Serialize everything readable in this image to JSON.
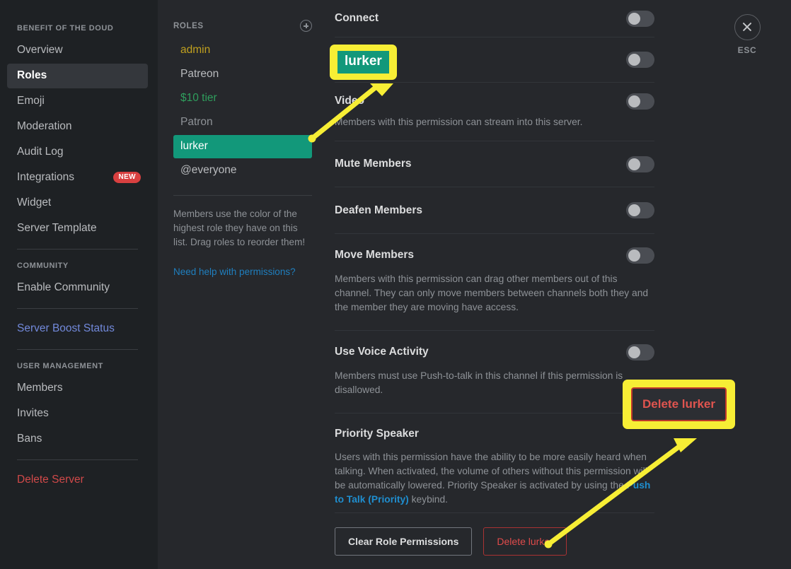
{
  "sidebar": {
    "server_header": "BENEFIT OF THE DOUD",
    "items": [
      {
        "label": "Overview"
      },
      {
        "label": "Roles"
      },
      {
        "label": "Emoji"
      },
      {
        "label": "Moderation"
      },
      {
        "label": "Audit Log"
      },
      {
        "label": "Integrations",
        "badge": "NEW"
      },
      {
        "label": "Widget"
      },
      {
        "label": "Server Template"
      }
    ],
    "community_header": "COMMUNITY",
    "community_items": [
      {
        "label": "Enable Community"
      }
    ],
    "boost_label": "Server Boost Status",
    "user_management_header": "USER MANAGEMENT",
    "user_items": [
      {
        "label": "Members"
      },
      {
        "label": "Invites"
      },
      {
        "label": "Bans"
      }
    ],
    "delete_server_label": "Delete Server"
  },
  "roles_panel": {
    "title": "ROLES",
    "add_icon": "plus-circle-icon",
    "roles": [
      {
        "label": "admin",
        "color": "#c0a01f"
      },
      {
        "label": "Patreon",
        "color": "#b9bbbe"
      },
      {
        "label": "$10 tier",
        "color": "#2f9e5d"
      },
      {
        "label": "Patron",
        "color": "#8e9297"
      },
      {
        "label": "lurker",
        "color": "#ffffff",
        "selected": true
      },
      {
        "label": "@everyone",
        "color": "#b9bbbe"
      }
    ],
    "help_text": "Members use the color of the highest role they have on this list. Drag roles to reorder them!",
    "help_link": "Need help with permissions?"
  },
  "permissions": [
    {
      "name": "Connect",
      "description": "",
      "enabled": false,
      "hidden_label": false
    },
    {
      "name": "",
      "description": "",
      "enabled": false,
      "hidden_label": true
    },
    {
      "name": "Video",
      "description": "Members with this permission can stream into this server.",
      "enabled": false,
      "hidden_label": false
    },
    {
      "name": "Mute Members",
      "description": "",
      "enabled": false,
      "hidden_label": false
    },
    {
      "name": "Deafen Members",
      "description": "",
      "enabled": false,
      "hidden_label": false
    },
    {
      "name": "Move Members",
      "description": "Members with this permission can drag other members out of this channel. They can only move members between channels both they and the member they are moving have access.",
      "enabled": false,
      "hidden_label": false
    },
    {
      "name": "Use Voice Activity",
      "description": "Members must use Push-to-talk in this channel if this permission is disallowed.",
      "enabled": false,
      "hidden_label": false
    }
  ],
  "priority_speaker": {
    "name": "Priority Speaker",
    "desc_part1": "Users with this permission have the ability to be more easily heard when talking. When activated, the volume of others without this permission will be automatically lowered. Priority Speaker is activated by using the ",
    "link_text": "Push to Talk (Priority)",
    "desc_part2": " keybind."
  },
  "footer_buttons": {
    "clear_label": "Clear Role Permissions",
    "delete_label": "Delete lurker"
  },
  "close": {
    "icon": "close-x-icon",
    "label": "ESC"
  },
  "annotations": {
    "callout_role_pill": "lurker",
    "callout_delete_button": "Delete lurker",
    "highlight_color": "#f7ee35"
  }
}
